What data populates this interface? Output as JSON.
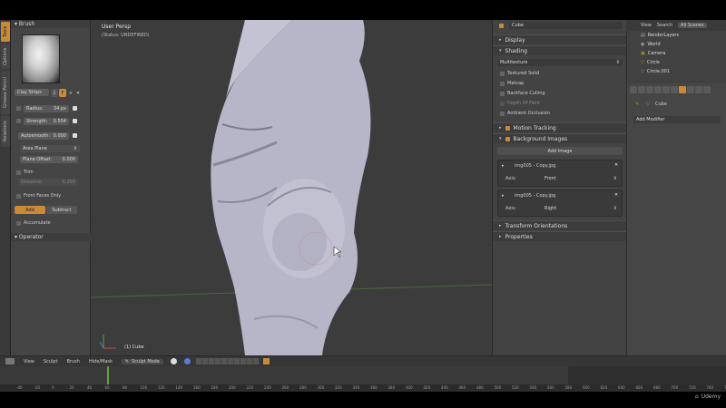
{
  "tabs": [
    "Tools",
    "Options",
    "Grease Pencil",
    "Relations"
  ],
  "toolshelf": {
    "brush_panel": "Brush",
    "brush_name": "Clay Strips",
    "brush_users": "2",
    "brush_fake": "F",
    "radius": {
      "label": "Radius:",
      "value": "34 px"
    },
    "strength": {
      "label": "Strength:",
      "value": "0.554"
    },
    "autosmooth": {
      "label": "Autosmooth:",
      "value": "0.000"
    },
    "plane": "Area Plane",
    "plane_offset": {
      "label": "Plane Offset:",
      "value": "0.000"
    },
    "trim": "Trim",
    "distance": {
      "label": "Distance:",
      "value": "0.250"
    },
    "front_faces": "Front Faces Only",
    "add": "Add",
    "subtract": "Subtract",
    "accumulate": "Accumulate",
    "operator_panel": "Operator"
  },
  "viewport": {
    "title": "User Persp",
    "status": "(Status: UNDEFINED)",
    "object": "(1) Cube"
  },
  "properties": {
    "object_name": "Cube",
    "display": "Display",
    "shading": "Shading",
    "shading_mode": "Multitexture",
    "textured_solid": "Textured Solid",
    "matcap": "Matcap",
    "backface_culling": "Backface Culling",
    "depth_of_field": "Depth Of Field",
    "ambient_occlusion": "Ambient Occlusion",
    "motion_tracking": "Motion Tracking",
    "background_images": "Background Images",
    "add_image": "Add Image",
    "images": [
      {
        "file": "img005 - Copy.jpg",
        "axis_label": "Axis:",
        "axis": "Front"
      },
      {
        "file": "img005 - Copy.jpg",
        "axis_label": "Axis:",
        "axis": "Right"
      }
    ],
    "transform_orientations": "Transform Orientations",
    "properties": "Properties"
  },
  "outliner": {
    "view": "View",
    "search": "Search",
    "all_scenes": "All Scenes",
    "items": [
      "RenderLayers",
      "World",
      "Camera",
      "Circle",
      "Circle.001"
    ]
  },
  "props_panel": {
    "object": "Cube",
    "add_modifier": "Add Modifier"
  },
  "header_bar": {
    "view": "View",
    "sculpt": "Sculpt",
    "brush": "Brush",
    "hide_mask": "Hide/Mask",
    "mode": "Sculpt Mode"
  },
  "ruler": [
    "-40",
    "-20",
    "0",
    "20",
    "40",
    "60",
    "80",
    "100",
    "120",
    "140",
    "160",
    "180",
    "200",
    "220",
    "240",
    "260",
    "280",
    "300",
    "320",
    "340",
    "360",
    "380",
    "400",
    "420",
    "440",
    "460",
    "480",
    "500",
    "520",
    "540",
    "560",
    "580",
    "600",
    "620",
    "640",
    "660",
    "680",
    "700",
    "720",
    "740",
    "760"
  ],
  "watermark": "Udemy",
  "colors": {
    "accent": "#c98a3a",
    "background": "#3c3c3c",
    "mesh": "#b7b6c8"
  }
}
